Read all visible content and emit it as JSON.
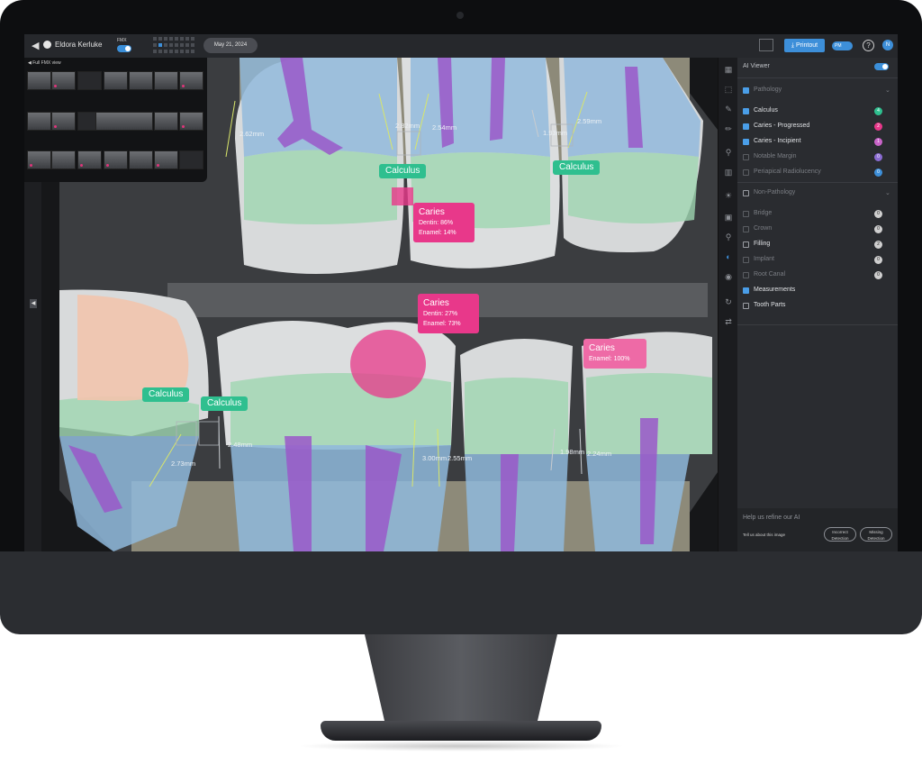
{
  "header": {
    "patient_name": "Eldora Kerluke",
    "fmx_label": "FMX",
    "date": "May 21, 2024",
    "printout_label": "Printout",
    "pm_label": "PM",
    "help_symbol": "?",
    "avatar_initial": "N"
  },
  "thumbnails": {
    "title": "Full FMX view"
  },
  "xray": {
    "labels": {
      "calculus": "Calculus",
      "caries": "Caries"
    },
    "caries_findings": [
      {
        "title": "Caries",
        "line1": "Dentin: 86%",
        "line2": "Enamel: 14%"
      },
      {
        "title": "Caries",
        "line1": "Dentin: 27%",
        "line2": "Enamel: 73%"
      },
      {
        "title": "Caries",
        "line1": "Enamel: 100%"
      }
    ],
    "measurements": [
      "2.62mm",
      "2.82mm",
      "2.54mm",
      "1.93mm",
      "2.59mm",
      "2.73mm",
      "2.48mm",
      "3.00mm",
      "2.55mm",
      "1.98mm",
      "2.24mm"
    ]
  },
  "panel": {
    "title": "AI Viewer",
    "pathology": {
      "label": "Pathology",
      "items": [
        {
          "label": "Calculus",
          "count": "4",
          "color": "#2fbf8f"
        },
        {
          "label": "Caries - Progressed",
          "count": "2",
          "color": "#e8388a"
        },
        {
          "label": "Caries - Incipient",
          "count": "1",
          "color": "#c964c8"
        },
        {
          "label": "Notable Margin",
          "count": "0",
          "color": "#8a6bd1"
        },
        {
          "label": "Periapical Radiolucency",
          "count": "0",
          "color": "#3d8fd9"
        }
      ]
    },
    "non_pathology": {
      "label": "Non-Pathology",
      "items": [
        {
          "label": "Bridge",
          "count": "0"
        },
        {
          "label": "Crown",
          "count": "0"
        },
        {
          "label": "Filling",
          "count": "2"
        },
        {
          "label": "Implant",
          "count": "0"
        },
        {
          "label": "Root Canal",
          "count": "0"
        },
        {
          "label": "Measurements"
        },
        {
          "label": "Tooth Parts"
        }
      ]
    },
    "refine": {
      "title": "Help us refine our AI",
      "tell": "Tell us about this image",
      "incorrect": "Incorrect Detection",
      "missing": "Missing Detection"
    }
  },
  "colors": {
    "accent": "#3d8fd9",
    "calculus": "#2fbf8f",
    "caries": "#e8388a",
    "enamel": "#9fd6b0",
    "pulp": "#9a58c9",
    "root": "#8fb8dc"
  }
}
